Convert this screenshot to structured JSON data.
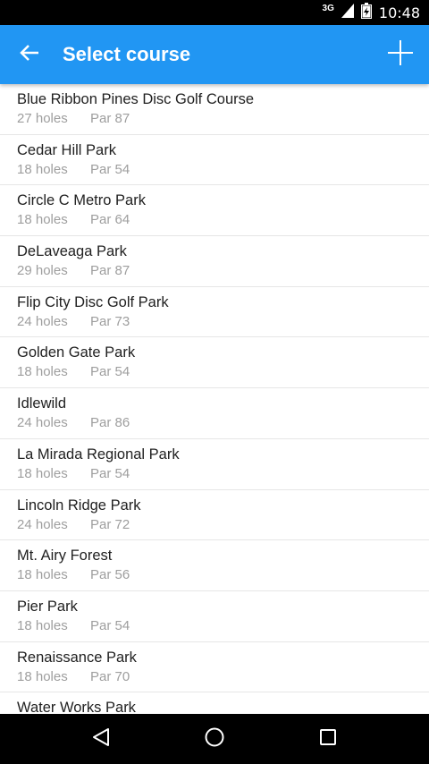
{
  "status_bar": {
    "network": "3G",
    "time": "10:48"
  },
  "app_bar": {
    "title": "Select course",
    "back_icon": "arrow-back-icon",
    "add_icon": "plus-icon",
    "color": "#2196f3"
  },
  "courses": [
    {
      "name": "Blue Ribbon Pines Disc Golf Course",
      "holes": "27 holes",
      "par": "Par 87"
    },
    {
      "name": "Cedar Hill Park",
      "holes": "18 holes",
      "par": "Par 54"
    },
    {
      "name": "Circle C Metro Park",
      "holes": "18 holes",
      "par": "Par 64"
    },
    {
      "name": "DeLaveaga Park",
      "holes": "29 holes",
      "par": "Par 87"
    },
    {
      "name": "Flip City Disc Golf Park",
      "holes": "24 holes",
      "par": "Par 73"
    },
    {
      "name": "Golden Gate Park",
      "holes": "18 holes",
      "par": "Par 54"
    },
    {
      "name": "Idlewild",
      "holes": "24 holes",
      "par": "Par 86"
    },
    {
      "name": "La Mirada Regional Park",
      "holes": "18 holes",
      "par": "Par 54"
    },
    {
      "name": "Lincoln Ridge Park",
      "holes": "24 holes",
      "par": "Par 72"
    },
    {
      "name": "Mt. Airy Forest",
      "holes": "18 holes",
      "par": "Par 56"
    },
    {
      "name": "Pier Park",
      "holes": "18 holes",
      "par": "Par 54"
    },
    {
      "name": "Renaissance Park",
      "holes": "18 holes",
      "par": "Par 70"
    },
    {
      "name": "Water Works Park",
      "holes": "",
      "par": ""
    }
  ],
  "nav_bar": {
    "back_icon": "triangle-back-icon",
    "home_icon": "circle-home-icon",
    "recents_icon": "square-recents-icon"
  }
}
